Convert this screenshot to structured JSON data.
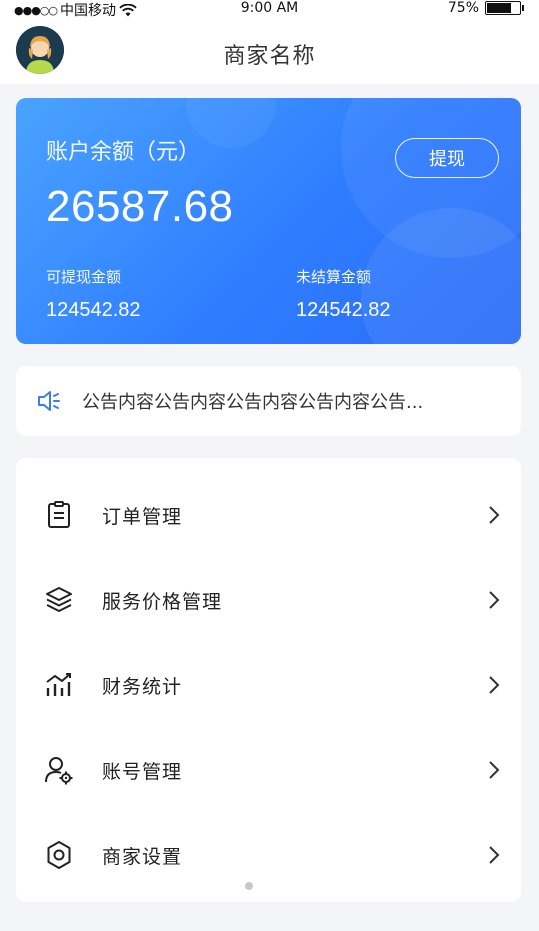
{
  "status_bar": {
    "signal": "●●●○○",
    "carrier": "中国移动",
    "time": "9:00 AM",
    "battery_text": "75%",
    "battery_level": 0.75
  },
  "header": {
    "title": "商家名称"
  },
  "balance": {
    "label": "账户余额（元）",
    "amount": "26587.68",
    "withdraw_label": "提现",
    "withdrawable_label": "可提现金额",
    "withdrawable_value": "124542.82",
    "unsettled_label": "未结算金额",
    "unsettled_value": "124542.82"
  },
  "notice": {
    "text": "公告内容公告内容公告内容公告内容公告..."
  },
  "menu": {
    "items": [
      {
        "label": "订单管理",
        "icon": "clipboard-icon"
      },
      {
        "label": "服务价格管理",
        "icon": "layers-icon"
      },
      {
        "label": "财务统计",
        "icon": "chart-icon"
      },
      {
        "label": "账号管理",
        "icon": "user-gear-icon"
      },
      {
        "label": "商家设置",
        "icon": "gear-icon"
      }
    ]
  },
  "colors": {
    "accent": "#2f7dff",
    "icon_blue": "#3b7cf6",
    "background": "#f4f5f7"
  }
}
